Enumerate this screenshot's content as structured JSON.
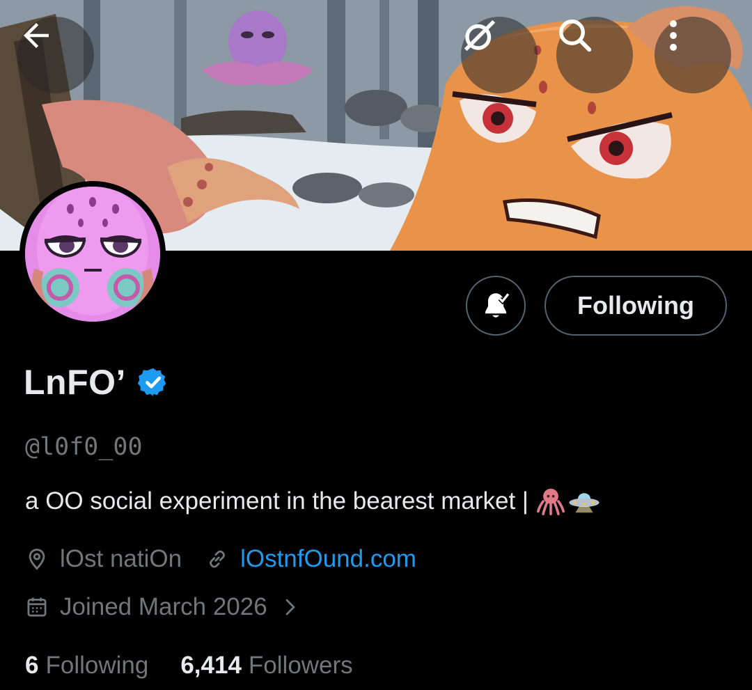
{
  "header": {
    "back_icon": "arrow-left-icon",
    "grok_icon": "grok-icon",
    "search_icon": "search-icon",
    "more_icon": "more-vertical-icon"
  },
  "actions": {
    "notify_icon": "bell-subscribed-icon",
    "following_label": "Following"
  },
  "profile": {
    "display_name": "LnFO’",
    "verified_icon": "verified-badge-icon",
    "handle": "@l0f0_00",
    "bio_text": "a OO social experiment in the bearest market |",
    "bio_emojis": [
      "octopus-emoji",
      "ufo-emoji"
    ],
    "location": "lOst natiOn",
    "website": "lOstnfOund.com",
    "joined": "Joined March 2026"
  },
  "stats": {
    "following_count": "6",
    "following_label": "Following",
    "followers_count": "6,414",
    "followers_label": "Followers"
  },
  "colors": {
    "background": "#000000",
    "primary_text": "#e7e9ea",
    "secondary_text": "#71767b",
    "link": "#1d9bf0",
    "border": "#536471",
    "verified": "#1d9bf0"
  }
}
